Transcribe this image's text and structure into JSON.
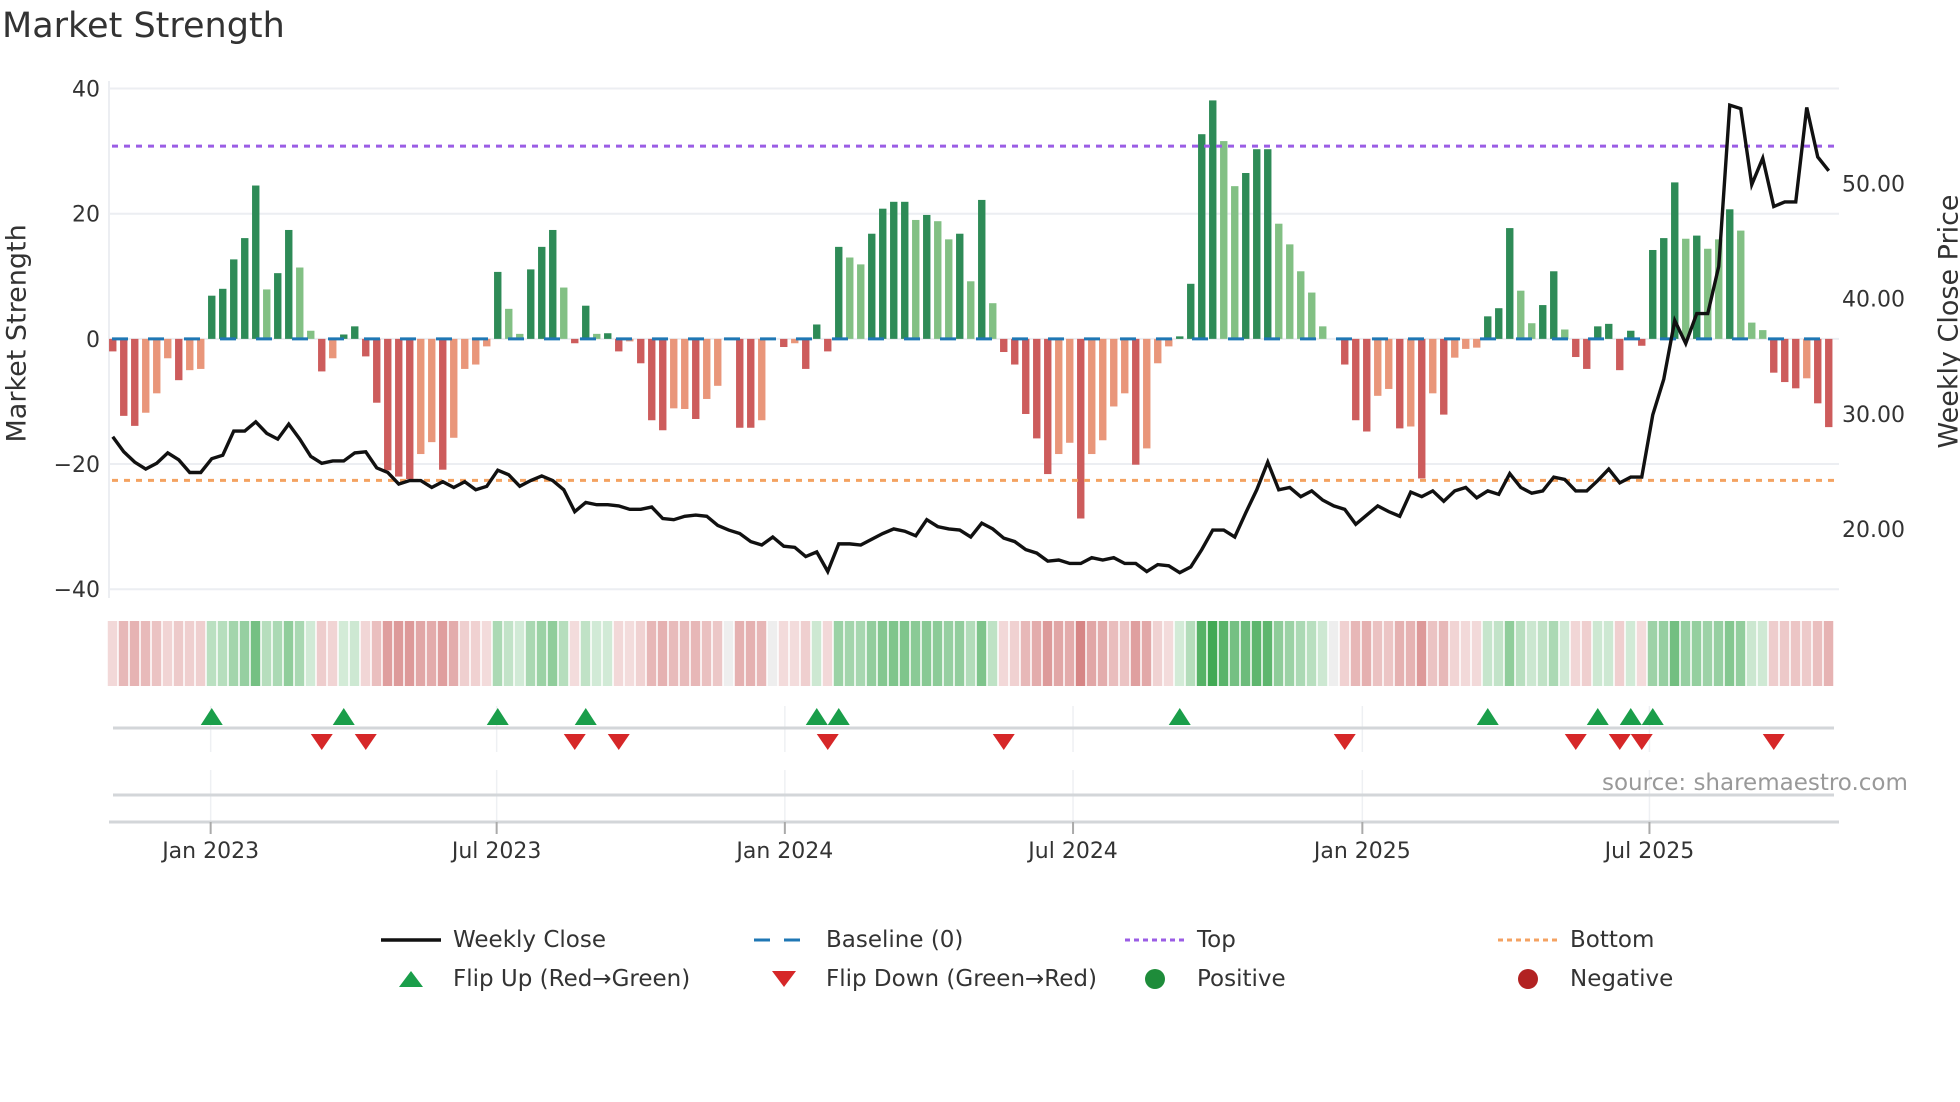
{
  "title": "Market Strength",
  "source": "source: sharemaestro.com",
  "chart_data": {
    "type": "bar+line",
    "title": "Market Strength",
    "ylabel": "Market Strength",
    "y2label": "Weekly Close Price",
    "ylim": [
      -41.4,
      41.2
    ],
    "y2lim": [
      14.0,
      58.9
    ],
    "yticks": [
      {
        "v": 40,
        "label": "40"
      },
      {
        "v": 20,
        "label": "20"
      },
      {
        "v": 0,
        "label": "0"
      },
      {
        "v": -20,
        "label": "−20"
      },
      {
        "v": -40,
        "label": "−40"
      }
    ],
    "y2ticks": [
      {
        "v": 50,
        "label": "50.00"
      },
      {
        "v": 40,
        "label": "40.00"
      },
      {
        "v": 30,
        "label": "30.00"
      },
      {
        "v": 20,
        "label": "20.00"
      }
    ],
    "xticks": [
      {
        "index": 8.9,
        "label": "Jan 2023"
      },
      {
        "index": 34.9,
        "label": "Jul 2023"
      },
      {
        "index": 61.1,
        "label": "Jan 2024"
      },
      {
        "index": 87.3,
        "label": "Jul 2024"
      },
      {
        "index": 113.6,
        "label": "Jan 2025"
      },
      {
        "index": 139.7,
        "label": "Jul 2025"
      }
    ],
    "top_level": 30.8,
    "bottom_level": -22.6,
    "baseline": 0,
    "strength": [
      -2,
      -12.3,
      -13.9,
      -11.8,
      -8.7,
      -3.1,
      -6.6,
      -5,
      -4.8,
      6.9,
      8.0,
      12.7,
      16.1,
      24.5,
      7.9,
      10.5,
      17.4,
      11.4,
      1.3,
      -5.2,
      -3.1,
      0.7,
      2.0,
      -2.8,
      -10.2,
      -21,
      -22,
      -22.4,
      -18.4,
      -16.5,
      -20.9,
      -15.8,
      -4.8,
      -4.1,
      -1.2,
      10.7,
      4.8,
      0.8,
      11.1,
      14.7,
      17.4,
      8.2,
      -0.7,
      5.3,
      0.8,
      0.9,
      -2,
      -0.4,
      -3.9,
      -13,
      -14.6,
      -11.1,
      -11.2,
      -12.8,
      -9.6,
      -7.5,
      0,
      -14.2,
      -14.2,
      -13,
      0,
      -1.3,
      -0.7,
      -4.8,
      2.3,
      -2,
      14.7,
      13,
      11.9,
      16.8,
      20.8,
      21.9,
      21.9,
      19,
      19.8,
      18.8,
      15.9,
      16.8,
      9.2,
      22.2,
      5.7,
      -2.1,
      -4.1,
      -12,
      -15.9,
      -21.6,
      -18.4,
      -16.6,
      -28.7,
      -18.4,
      -16.2,
      -10.8,
      -8.7,
      -20.1,
      -17.5,
      -3.9,
      -1.2,
      0.4,
      8.8,
      32.7,
      38.1,
      31.6,
      24.4,
      26.5,
      30.3,
      30.3,
      18.4,
      15.1,
      10.8,
      7.4,
      2,
      0,
      -4.1,
      -13,
      -14.8,
      -9.1,
      -8,
      -14.3,
      -14,
      -22.3,
      -8.7,
      -12.1,
      -3,
      -1.6,
      -1.4,
      3.6,
      4.9,
      17.7,
      7.7,
      2.5,
      5.4,
      10.8,
      1.5,
      -2.9,
      -4.8,
      2.0,
      2.4,
      -5,
      1.3,
      -1.1,
      14.2,
      16.1,
      25,
      16,
      16.5,
      14.4,
      15.9,
      20.7,
      17.3,
      2.6,
      1.4,
      -5.4,
      -6.9,
      -7.9,
      -6.3,
      -10.3,
      -14.1
    ],
    "tone": "RRRrrrRrrGGGGGgGGggRrGGRRRRRrrRrrrrGggGGGgRGgGRrRRRrrRrr RRr RrRGRGggGGGGgGggGgGgRRRRRrrRrrrrRrrrGGGGggGGGggggg RRRrrRrRrRrrrGGGggGGgRRGGRGRGGGgGggGgggRRRrRR",
    "close": [
      28.0,
      26.7,
      25.8,
      25.2,
      25.7,
      26.6,
      26.0,
      24.9,
      24.9,
      26.1,
      26.4,
      28.5,
      28.5,
      29.3,
      28.3,
      27.8,
      29.1,
      27.8,
      26.3,
      25.7,
      25.9,
      25.9,
      26.6,
      26.7,
      25.3,
      24.9,
      23.9,
      24.2,
      24.2,
      23.6,
      24.1,
      23.6,
      24.1,
      23.4,
      23.7,
      25.1,
      24.7,
      23.7,
      24.2,
      24.6,
      24.2,
      23.4,
      21.5,
      22.3,
      22.1,
      22.1,
      22.0,
      21.7,
      21.7,
      21.9,
      20.9,
      20.8,
      21.1,
      21.2,
      21.1,
      20.3,
      19.9,
      19.6,
      18.9,
      18.6,
      19.3,
      18.5,
      18.4,
      17.6,
      18.0,
      16.3,
      18.7,
      18.7,
      18.6,
      19.1,
      19.6,
      20.0,
      19.8,
      19.4,
      20.8,
      20.2,
      20.0,
      19.9,
      19.3,
      20.5,
      20.0,
      19.2,
      18.9,
      18.2,
      17.9,
      17.2,
      17.3,
      17.0,
      17.0,
      17.5,
      17.3,
      17.5,
      17.0,
      17.0,
      16.3,
      16.9,
      16.8,
      16.2,
      16.7,
      18.2,
      19.9,
      19.9,
      19.3,
      21.4,
      23.4,
      25.8,
      23.4,
      23.6,
      22.8,
      23.3,
      22.5,
      22.0,
      21.7,
      20.4,
      21.2,
      22.0,
      21.5,
      21.1,
      23.2,
      22.8,
      23.3,
      22.4,
      23.3,
      23.6,
      22.7,
      23.3,
      23.0,
      24.8,
      23.6,
      23.1,
      23.3,
      24.5,
      24.3,
      23.3,
      23.3,
      24.2,
      25.2,
      24.0,
      24.5,
      24.5,
      29.9,
      33.0,
      38.1,
      36.1,
      38.7,
      38.7,
      42.8,
      56.8,
      56.5,
      49.9,
      52.2,
      48.0,
      48.4,
      48.4,
      56.6,
      52.3,
      51.1
    ],
    "flips_up": [
      9,
      21,
      35,
      43,
      64,
      66,
      97,
      125,
      135,
      138,
      140
    ],
    "flips_down": [
      19,
      23,
      42,
      46,
      65,
      81,
      112,
      133,
      137,
      139,
      151
    ],
    "legend": [
      {
        "label": "Weekly Close",
        "kind": "line",
        "color": "#111111"
      },
      {
        "label": "Baseline (0)",
        "kind": "dash",
        "color": "#1f77b4"
      },
      {
        "label": "Top",
        "kind": "dot",
        "color": "#9b5de5"
      },
      {
        "label": "Bottom",
        "kind": "dot",
        "color": "#f4a261"
      },
      {
        "label": "Flip Up (Red→Green)",
        "kind": "tri-up",
        "color": "#1a9e4a"
      },
      {
        "label": "Flip Down (Green→Red)",
        "kind": "tri-down",
        "color": "#d62728"
      },
      {
        "label": "Positive",
        "kind": "circle",
        "color": "#1e8c3a"
      },
      {
        "label": "Negative",
        "kind": "circle",
        "color": "#b22222"
      }
    ]
  },
  "colors": {
    "G": "#2e8b57",
    "g": "#82c084",
    "R": "#cd5c5c",
    "r": "#e9967a",
    "baseline": "#1f77b4",
    "top": "#9b5de5",
    "bottom": "#f4a261",
    "up": "#1a9e4a",
    "down": "#d62728"
  }
}
